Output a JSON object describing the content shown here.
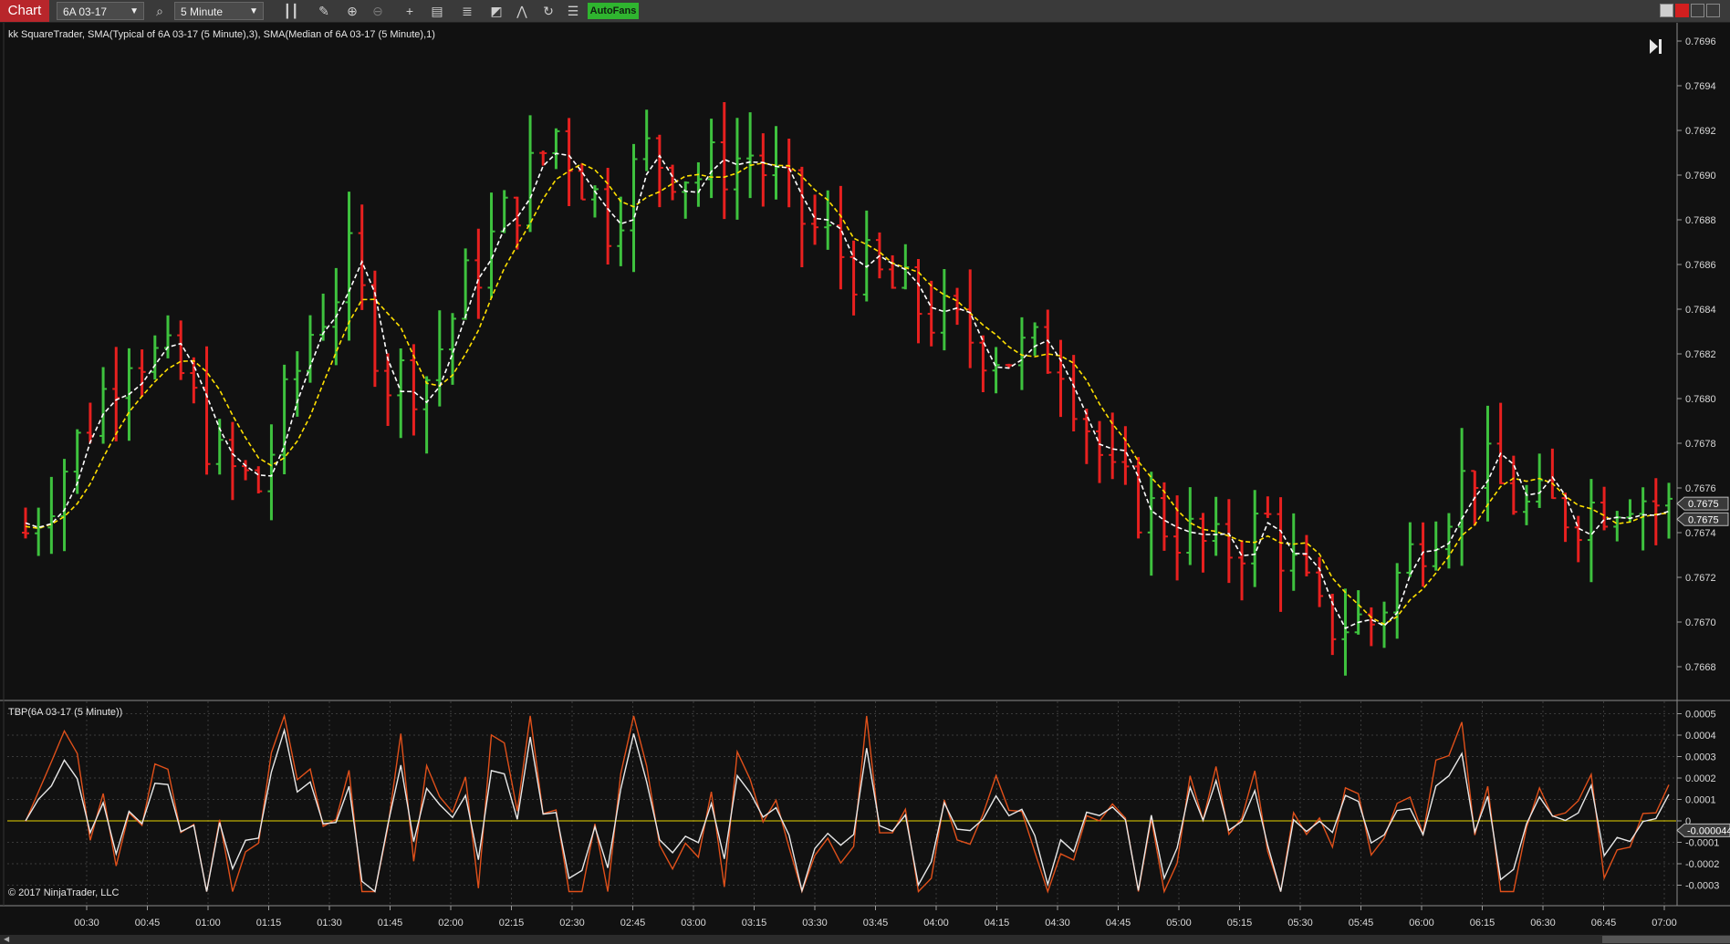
{
  "toolbar": {
    "chart_tab": "Chart",
    "instrument": "6A 03-17",
    "interval": "5 Minute",
    "autofans": "AutoFans",
    "icons": [
      "search-icon",
      "bar-type-icon",
      "pencil-icon",
      "zoom-in-icon",
      "zoom-out-icon",
      "crosshair-icon",
      "data-box-icon",
      "chart-trader-icon",
      "stack-icon",
      "strategy-icon",
      "refresh-icon",
      "properties-icon"
    ]
  },
  "price_panel": {
    "title": "kk SquareTrader, SMA(Typical of 6A 03-17 (5 Minute),3), SMA(Median of 6A 03-17 (5 Minute),1)",
    "y_ticks": [
      "0.7696",
      "0.7694",
      "0.7692",
      "0.7690",
      "0.7688",
      "0.7686",
      "0.7684",
      "0.7682",
      "0.7680",
      "0.7678",
      "0.7676",
      "0.7674",
      "0.7672",
      "0.7670",
      "0.7668"
    ],
    "last_labels": [
      "0.7675",
      "0.7675"
    ],
    "colors": {
      "up": "#3ec23e",
      "down": "#e8201f",
      "sma_typical": "#ffffff",
      "sma_median": "#ffe000"
    }
  },
  "indicator_panel": {
    "title": "TBP(6A 03-17 (5 Minute))",
    "y_ticks": [
      "0.0005",
      "0.0004",
      "0.0003",
      "0.0002",
      "0.0001",
      "0",
      "-0.0001",
      "-0.0002",
      "-0.0003"
    ],
    "last_label": "-0.000044",
    "copyright": "© 2017 NinjaTrader, LLC",
    "colors": {
      "white": "#e8e8e8",
      "orange": "#e0501a",
      "zero": "#e6d200"
    }
  },
  "x_axis": {
    "labels": [
      "00:30",
      "00:45",
      "01:00",
      "01:15",
      "01:30",
      "01:45",
      "02:00",
      "02:15",
      "02:30",
      "02:45",
      "03:00",
      "03:15",
      "03:30",
      "03:45",
      "04:00",
      "04:15",
      "04:30",
      "04:45",
      "05:00",
      "05:15",
      "05:30",
      "05:45",
      "06:00",
      "06:15",
      "06:30",
      "06:45",
      "07:00"
    ]
  }
}
